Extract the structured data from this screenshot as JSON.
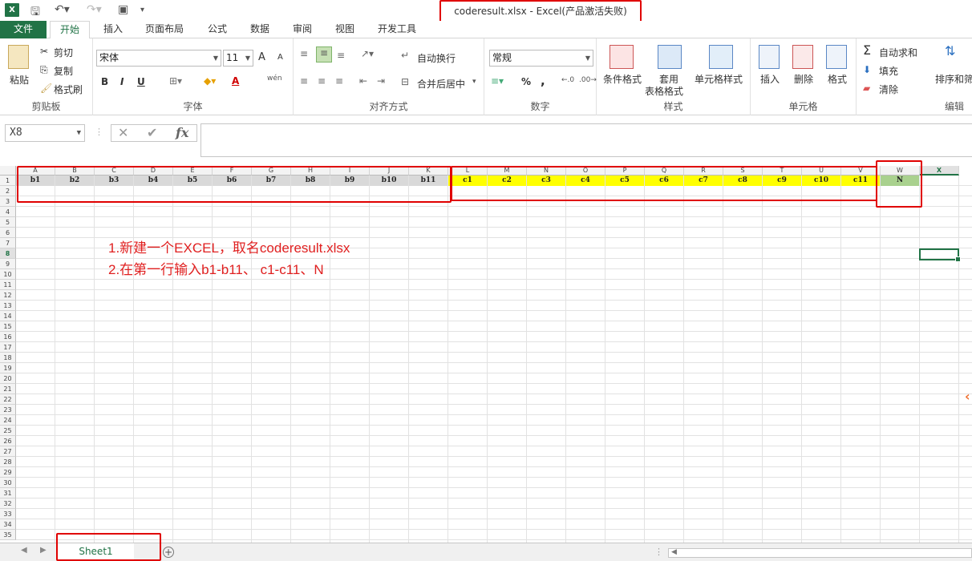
{
  "window": {
    "app_icon": "X",
    "title": "coderesult.xlsx - Excel(产品激活失败)"
  },
  "tabs": [
    {
      "label": "文件"
    },
    {
      "label": "开始"
    },
    {
      "label": "插入"
    },
    {
      "label": "页面布局"
    },
    {
      "label": "公式"
    },
    {
      "label": "数据"
    },
    {
      "label": "审阅"
    },
    {
      "label": "视图"
    },
    {
      "label": "开发工具"
    }
  ],
  "ribbon": {
    "clipboard": {
      "paste": "粘贴",
      "cut": "剪切",
      "copy": "复制",
      "format_painter": "格式刷",
      "label": "剪贴板"
    },
    "font": {
      "name": "宋体",
      "size": "11",
      "bold": "B",
      "italic": "I",
      "underline": "U",
      "grow": "A",
      "shrink": "A",
      "font_color": "A",
      "pinyin": "wén",
      "label": "字体"
    },
    "alignment": {
      "wrap": "自动换行",
      "merge": "合并后居中",
      "label": "对齐方式"
    },
    "number": {
      "format": "常规",
      "percent": "%",
      "comma": ",",
      "label": "数字"
    },
    "styles": {
      "conditional": "条件格式",
      "table_line1": "套用",
      "table_line2": "表格格式",
      "cell_styles": "单元格样式",
      "label": "样式"
    },
    "cells": {
      "insert": "插入",
      "delete": "删除",
      "format": "格式",
      "label": "单元格"
    },
    "editing": {
      "autosum": "自动求和",
      "fill": "填充",
      "clear": "清除",
      "sort": "排序和筛",
      "label": "编辑"
    }
  },
  "formula_bar": {
    "name_box": "X8",
    "fx": "fx",
    "value": ""
  },
  "sheet": {
    "columns": [
      "A",
      "B",
      "C",
      "D",
      "E",
      "F",
      "G",
      "H",
      "I",
      "J",
      "K",
      "L",
      "M",
      "N",
      "O",
      "P",
      "Q",
      "R",
      "S",
      "T",
      "U",
      "V",
      "W",
      "X"
    ],
    "row1": [
      "b1",
      "b2",
      "b3",
      "b4",
      "b5",
      "b6",
      "b7",
      "b8",
      "b9",
      "b10",
      "b11",
      "c1",
      "c2",
      "c3",
      "c4",
      "c5",
      "c6",
      "c7",
      "c8",
      "c9",
      "c10",
      "c11",
      "N",
      ""
    ],
    "rows": [
      "1",
      "2",
      "3",
      "4",
      "5",
      "6",
      "7",
      "8",
      "9",
      "10",
      "11",
      "12",
      "13",
      "14",
      "15",
      "16",
      "17",
      "18",
      "19",
      "20",
      "21",
      "22",
      "23",
      "24",
      "25",
      "26",
      "27",
      "28",
      "29",
      "30",
      "31",
      "32",
      "33",
      "34",
      "35"
    ],
    "selected_cell": "X8",
    "colors": {
      "b_fill": "#d9d9d9",
      "c_fill": "#ffff00",
      "n_fill": "#a9d18e"
    }
  },
  "annotations": {
    "line1": "1.新建一个EXCEL，取名coderesult.xlsx",
    "line2": "2.在第一行输入b1-b11、 c1-c11、N"
  },
  "status": {
    "sheet_tab": "Sheet1",
    "add_sheet": "+"
  }
}
